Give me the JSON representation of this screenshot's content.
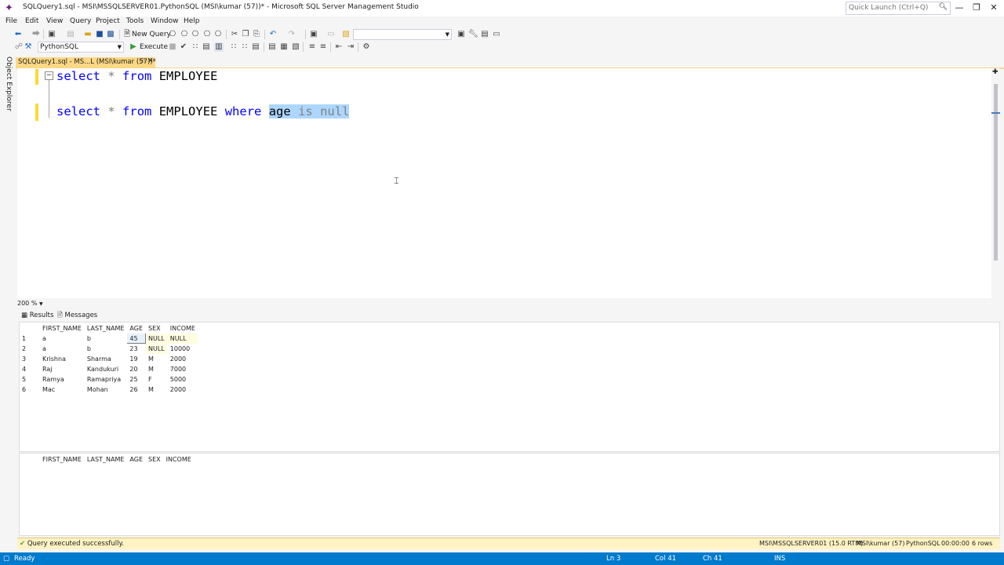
{
  "window": {
    "title": "SQLQuery1.sql - MSI\\MSSQLSERVER01.PythonSQL (MSI\\kumar (57))* - Microsoft SQL Server Management Studio",
    "quick_launch_placeholder": "Quick Launch (Ctrl+Q)"
  },
  "menu": [
    "File",
    "Edit",
    "View",
    "Query",
    "Project",
    "Tools",
    "Window",
    "Help"
  ],
  "toolbar": {
    "new_query_label": "New Query",
    "database": "PythonSQL",
    "execute_label": "Execute"
  },
  "side_panel": {
    "object_explorer_label": "Object Explorer"
  },
  "document_tab": {
    "label": "SQLQuery1.sql - MS...L (MSI\\kumar (57))*"
  },
  "editor": {
    "line1": {
      "kw1": "select",
      "op": "*",
      "kw2": "from",
      "table": "EMPLOYEE"
    },
    "line3": {
      "kw1": "select",
      "op": "*",
      "kw2": "from",
      "table": "EMPLOYEE",
      "kw3": "where",
      "col": "age",
      "is": "is",
      "null": "null"
    },
    "zoom": "200 %"
  },
  "results_tabs": {
    "results": "Results",
    "messages": "Messages"
  },
  "grid1": {
    "columns": [
      "FIRST_NAME",
      "LAST_NAME",
      "AGE",
      "SEX",
      "INCOME"
    ],
    "rows": [
      [
        "1",
        "a",
        "b",
        "45",
        "NULL",
        "NULL"
      ],
      [
        "2",
        "a",
        "b",
        "23",
        "NULL",
        "10000"
      ],
      [
        "3",
        "Krishna",
        "Sharma",
        "19",
        "M",
        "2000"
      ],
      [
        "4",
        "Raj",
        "Kandukuri",
        "20",
        "M",
        "7000"
      ],
      [
        "5",
        "Ramya",
        "Ramapriya",
        "25",
        "F",
        "5000"
      ],
      [
        "6",
        "Mac",
        "Mohan",
        "26",
        "M",
        "2000"
      ]
    ]
  },
  "grid2": {
    "columns": [
      "FIRST_NAME",
      "LAST_NAME",
      "AGE",
      "SEX",
      "INCOME"
    ]
  },
  "query_status": {
    "message": "Query executed successfully.",
    "server": "MSI\\MSSQLSERVER01 (15.0 RTM)",
    "user": "MSI\\kumar (57)",
    "database": "PythonSQL",
    "time": "00:00:00",
    "rows": "6 rows"
  },
  "status_bar": {
    "ready": "Ready",
    "ln": "Ln 3",
    "col": "Col 41",
    "ch": "Ch 41",
    "mode": "INS"
  }
}
